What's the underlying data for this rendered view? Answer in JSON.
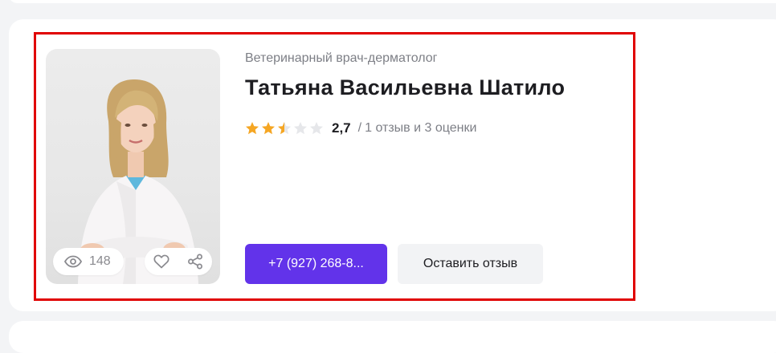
{
  "doctor": {
    "specialty": "Ветеринарный врач-дерматолог",
    "name": "Татьяна Васильевна Шатило",
    "photo_alt": "doctor-portrait"
  },
  "rating": {
    "value": "2,7",
    "separator": "/",
    "reviews_text": "1 отзыв и 3 оценки",
    "stars_total": 5,
    "stars_filled": 2.5,
    "star_color": "#f5a623",
    "star_empty_color": "#e6e7ea"
  },
  "stats": {
    "views": "148",
    "views_icon": "eye-icon",
    "favorite_icon": "heart-icon",
    "share_icon": "share-icon"
  },
  "actions": {
    "phone_label": "+7 (927) 268-8...",
    "review_label": "Оставить отзыв"
  },
  "colors": {
    "accent": "#6233ea",
    "highlight_border": "#e00000",
    "muted_text": "#7d7f86"
  }
}
